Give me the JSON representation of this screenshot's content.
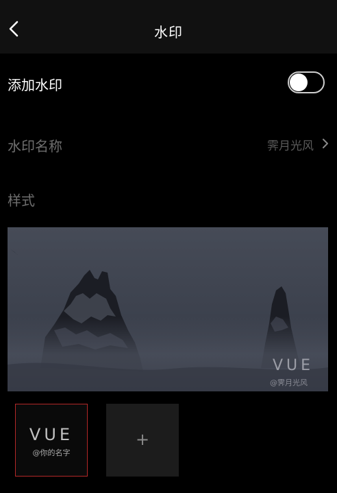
{
  "header": {
    "title": "水印"
  },
  "add_watermark": {
    "label": "添加水印",
    "enabled": false
  },
  "watermark_name": {
    "label": "水印名称",
    "value": "霁月光风"
  },
  "style": {
    "label": "样式"
  },
  "preview": {
    "watermark_title": "VUE",
    "watermark_subtitle": "@霁月光风"
  },
  "styles": [
    {
      "title": "VUE",
      "subtitle": "@你的名字",
      "selected": true
    },
    {
      "plus": "+"
    }
  ],
  "colors": {
    "selected_border": "#b42828",
    "background": "#000000",
    "header": "#111111"
  },
  "icons": {
    "back": "chevron-left-icon",
    "arrow": "chevron-right-icon",
    "add": "plus-icon"
  }
}
